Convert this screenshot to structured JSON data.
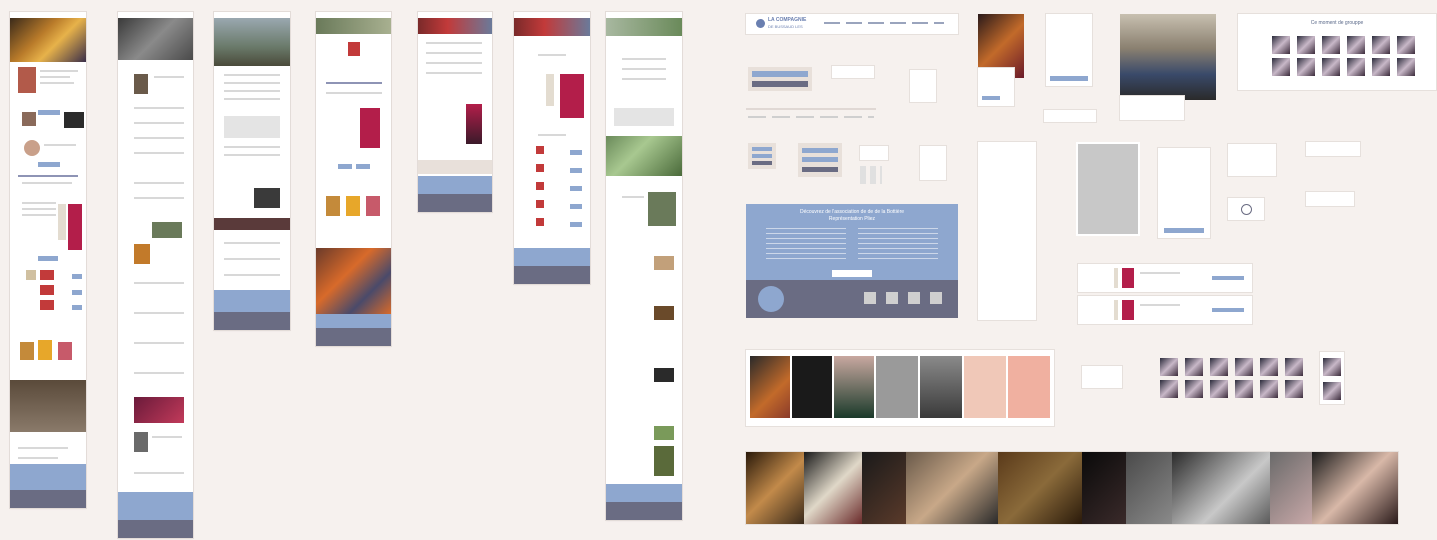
{
  "site": {
    "logo_title": "LA COMPAGNIE",
    "logo_subtitle": "DE BUSSAUD LES"
  },
  "banner": {
    "title_line1": "Découvrez de l'association de de de la Bottière",
    "title_line2": "Représentation Pliez"
  },
  "gallery": {
    "title": "Ce moment de grouppe"
  },
  "colors": {
    "background": "#f6f1ee",
    "accent_blue": "#8ea7cf",
    "footer_navy": "#6a6c83"
  }
}
